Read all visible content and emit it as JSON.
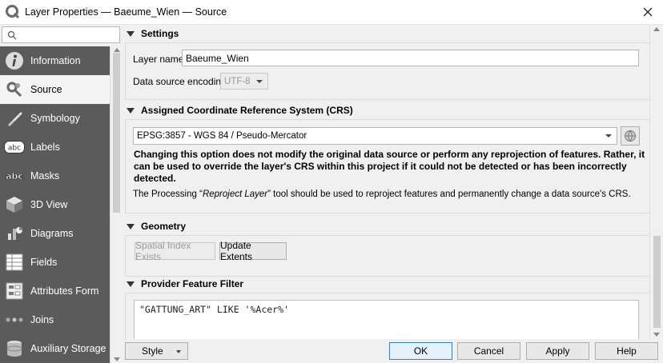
{
  "window": {
    "title": "Layer Properties — Baeume_Wien — Source",
    "icons": {
      "app": "qgis-logo-icon",
      "close": "close-icon"
    }
  },
  "sidebar": {
    "search_placeholder": "",
    "items": [
      {
        "label": "Information",
        "icon": "information-icon",
        "active": false
      },
      {
        "label": "Source",
        "icon": "source-wrench-icon",
        "active": true
      },
      {
        "label": "Symbology",
        "icon": "symbology-brush-icon",
        "active": false
      },
      {
        "label": "Labels",
        "icon": "labels-abc-icon",
        "active": false
      },
      {
        "label": "Masks",
        "icon": "masks-abc-icon",
        "active": false
      },
      {
        "label": "3D View",
        "icon": "3d-cube-icon",
        "active": false
      },
      {
        "label": "Diagrams",
        "icon": "diagrams-icon",
        "active": false
      },
      {
        "label": "Fields",
        "icon": "fields-table-icon",
        "active": false
      },
      {
        "label": "Attributes Form",
        "icon": "attributes-form-icon",
        "active": false
      },
      {
        "label": "Joins",
        "icon": "joins-icon",
        "active": false
      },
      {
        "label": "Auxiliary Storage",
        "icon": "auxiliary-storage-icon",
        "active": false
      }
    ]
  },
  "settings": {
    "header": "Settings",
    "layer_name_label": "Layer name",
    "layer_name_value": "Baeume_Wien",
    "encoding_label": "Data source encoding",
    "encoding_value": "UTF-8"
  },
  "crs": {
    "header": "Assigned Coordinate Reference System (CRS)",
    "value": "EPSG:3857 - WGS 84 / Pseudo-Mercator",
    "warning_line1": "Changing this option does not modify the original data source or perform any reprojection of features. Rather, it",
    "warning_line2": "can be used to override the layer's CRS within this project if it could not be detected or has been incorrectly",
    "warning_line3": "detected.",
    "note_prefix": "The Processing “",
    "note_tool": "Reproject Layer",
    "note_suffix": "” tool should be used to reproject features and permanently change a data source's CRS."
  },
  "geometry": {
    "header": "Geometry",
    "spatial_index_label": "Spatial Index Exists",
    "update_extents_label": "Update Extents"
  },
  "filter": {
    "header": "Provider Feature Filter",
    "expression": "\"GATTUNG_ART\" LIKE '%Acer%'"
  },
  "footer": {
    "style_label": "Style",
    "ok_label": "OK",
    "cancel_label": "Cancel",
    "apply_label": "Apply",
    "help_label": "Help"
  }
}
